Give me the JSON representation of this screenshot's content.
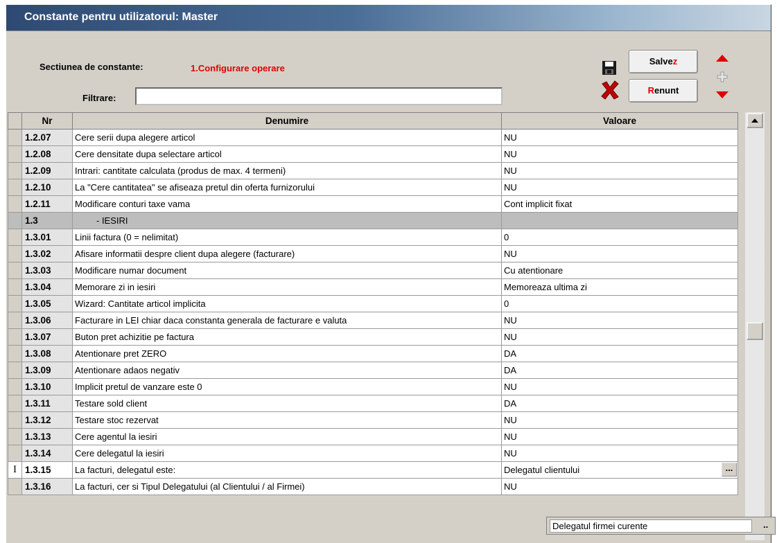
{
  "window": {
    "title": "Constante pentru utilizatorul: Master"
  },
  "header": {
    "section_label": "Sectiunea de constante:",
    "section_value": "1.Configurare operare",
    "filter_label": "Filtrare:",
    "filter_value": "",
    "save_btn": {
      "label": "Salve",
      "hotkey": "z"
    },
    "cancel_btn": {
      "hotkey": "R",
      "label": "enunt"
    }
  },
  "icons": {
    "save": "floppy-disk-icon",
    "cancel": "red-x-icon",
    "move_up": "red-triangle-up-icon",
    "add": "plus-icon",
    "move_down": "red-triangle-down-icon",
    "row_cursor": "text-cursor-icon"
  },
  "colors": {
    "accent_red": "#e00000",
    "title_bar": "#2e4a72",
    "section_row": "#bdbdbd"
  },
  "grid": {
    "columns": [
      "Nr",
      "Denumire",
      "Valoare"
    ],
    "rows": [
      {
        "nr": "1.2.07",
        "name": "Cere serii dupa alegere articol",
        "value": "NU"
      },
      {
        "nr": "1.2.08",
        "name": "Cere densitate dupa selectare articol",
        "value": "NU"
      },
      {
        "nr": "1.2.09",
        "name": "Intrari: cantitate calculata (produs de max. 4 termeni)",
        "value": "NU"
      },
      {
        "nr": "1.2.10",
        "name": "La \"Cere cantitatea\" se afiseaza pretul din oferta furnizorului",
        "value": "NU"
      },
      {
        "nr": "1.2.11",
        "name": "Modificare conturi taxe vama",
        "value": "Cont implicit fixat"
      },
      {
        "nr": "1.3",
        "name": "- IESIRI",
        "value": ""
      },
      {
        "nr": "1.3.01",
        "name": "Linii factura (0 = nelimitat)",
        "value": "0"
      },
      {
        "nr": "1.3.02",
        "name": "Afisare informatii despre client dupa alegere (facturare)",
        "value": "NU"
      },
      {
        "nr": "1.3.03",
        "name": "Modificare numar document",
        "value": "Cu atentionare"
      },
      {
        "nr": "1.3.04",
        "name": "Memorare zi in iesiri",
        "value": "Memoreaza ultima zi"
      },
      {
        "nr": "1.3.05",
        "name": "Wizard: Cantitate articol implicita",
        "value": "0"
      },
      {
        "nr": "1.3.06",
        "name": "Facturare in LEI chiar daca constanta generala de facturare e valuta",
        "value": "NU"
      },
      {
        "nr": "1.3.07",
        "name": "Buton pret achizitie pe factura",
        "value": "NU"
      },
      {
        "nr": "1.3.08",
        "name": "Atentionare pret ZERO",
        "value": "DA"
      },
      {
        "nr": "1.3.09",
        "name": "Atentionare adaos negativ",
        "value": "DA"
      },
      {
        "nr": "1.3.10",
        "name": "Implicit pretul de vanzare este 0",
        "value": "NU"
      },
      {
        "nr": "1.3.11",
        "name": "Testare sold client",
        "value": "DA"
      },
      {
        "nr": "1.3.12",
        "name": "Testare stoc rezervat",
        "value": "NU"
      },
      {
        "nr": "1.3.13",
        "name": "Cere agentul la iesiri",
        "value": "NU"
      },
      {
        "nr": "1.3.14",
        "name": "Cere delegatul la iesiri",
        "value": "NU"
      },
      {
        "nr": "1.3.15",
        "name": "La facturi, delegatul este:",
        "value": "Delegatul clientului"
      },
      {
        "nr": "1.3.16",
        "name": "La facturi, cer si Tipul Delegatului (al Clientului / al Firmei)",
        "value": "NU"
      }
    ],
    "current_indicator": "I",
    "ellipsis": "..."
  },
  "dropdown": {
    "option": "Delegatul firmei curente",
    "dots": ".."
  }
}
